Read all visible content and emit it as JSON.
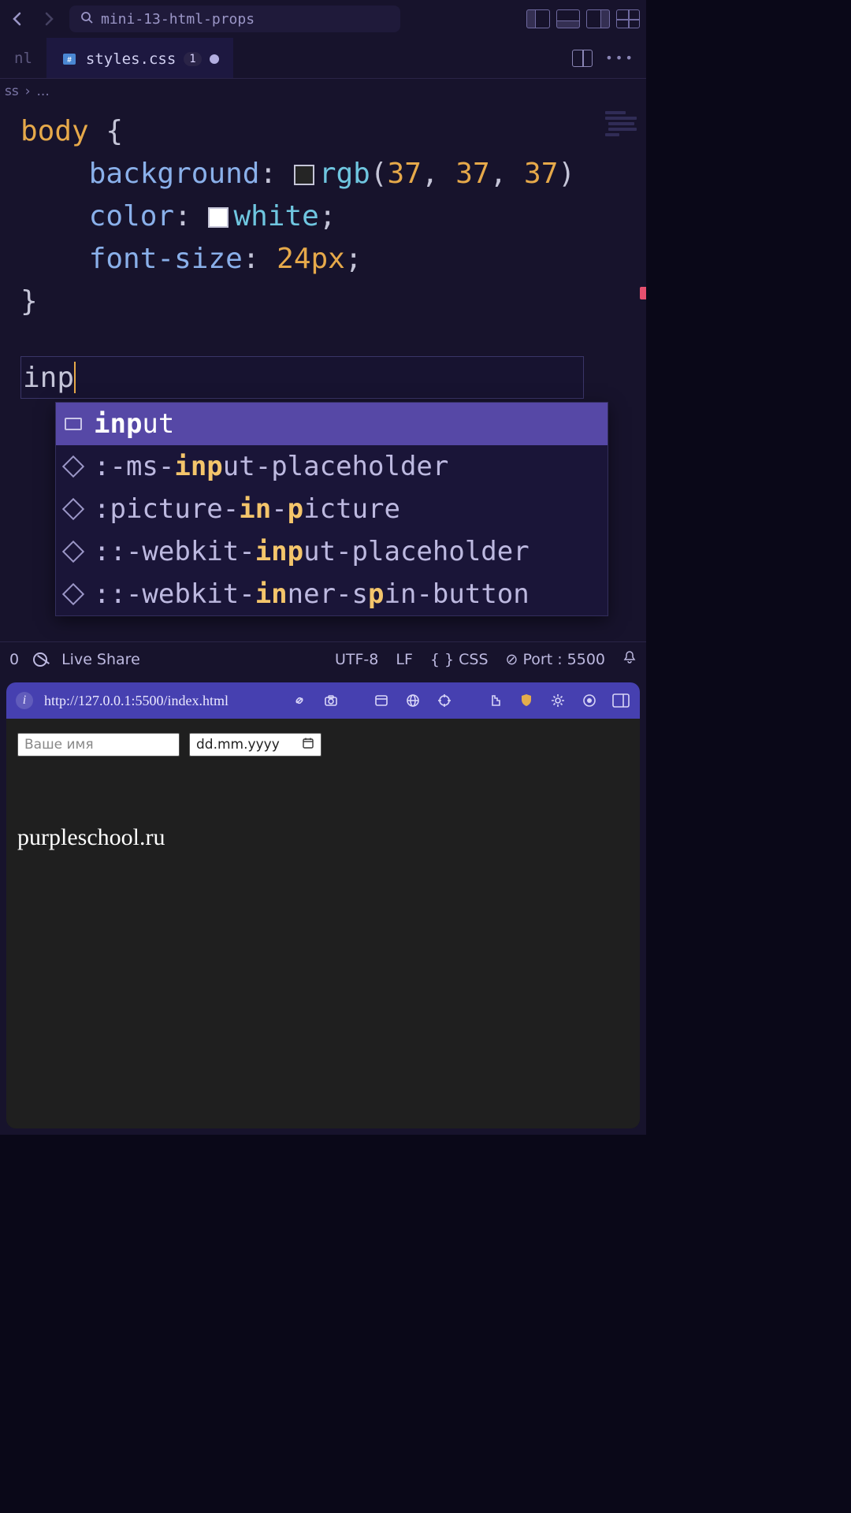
{
  "titlebar": {
    "project": "mini-13-html-props"
  },
  "tabs": {
    "inactive": "nl",
    "active_file": "styles.css",
    "badge": "1"
  },
  "breadcrumb": {
    "first": "ss",
    "sep": "›",
    "second": "..."
  },
  "code": {
    "selector": "body",
    "brace_open": "{",
    "bg_prop": "background",
    "bg_fn": "rgb",
    "bg_r": "37",
    "bg_g": "37",
    "bg_b": "37",
    "color_prop": "color",
    "color_val": "white",
    "fs_prop": "font-size",
    "fs_val": "24px",
    "brace_close": "}",
    "typed": "inp"
  },
  "suggest": [
    {
      "kind": "snippet",
      "parts": [
        "",
        "inp",
        "ut"
      ]
    },
    {
      "kind": "cube",
      "parts": [
        ":-ms-",
        "inp",
        "ut-placeholder"
      ]
    },
    {
      "kind": "cube",
      "parts": [
        ":picture-",
        "in",
        "-",
        "p",
        "icture"
      ]
    },
    {
      "kind": "cube",
      "parts": [
        "::-webkit-",
        "inp",
        "ut-placeholder"
      ]
    },
    {
      "kind": "cube",
      "parts": [
        "::-webkit-",
        "in",
        "ner-s",
        "p",
        "in-button"
      ]
    }
  ],
  "status": {
    "left_num": "0",
    "live_share": "Live Share",
    "encoding": "UTF-8",
    "eol": "LF",
    "lang": "CSS",
    "port": "Port : 5500"
  },
  "browser": {
    "url": "http://127.0.0.1:5500/index.html",
    "name_placeholder": "Ваше имя",
    "date_placeholder": "dd.mm.yyyy",
    "brand": "purpleschool.ru"
  }
}
